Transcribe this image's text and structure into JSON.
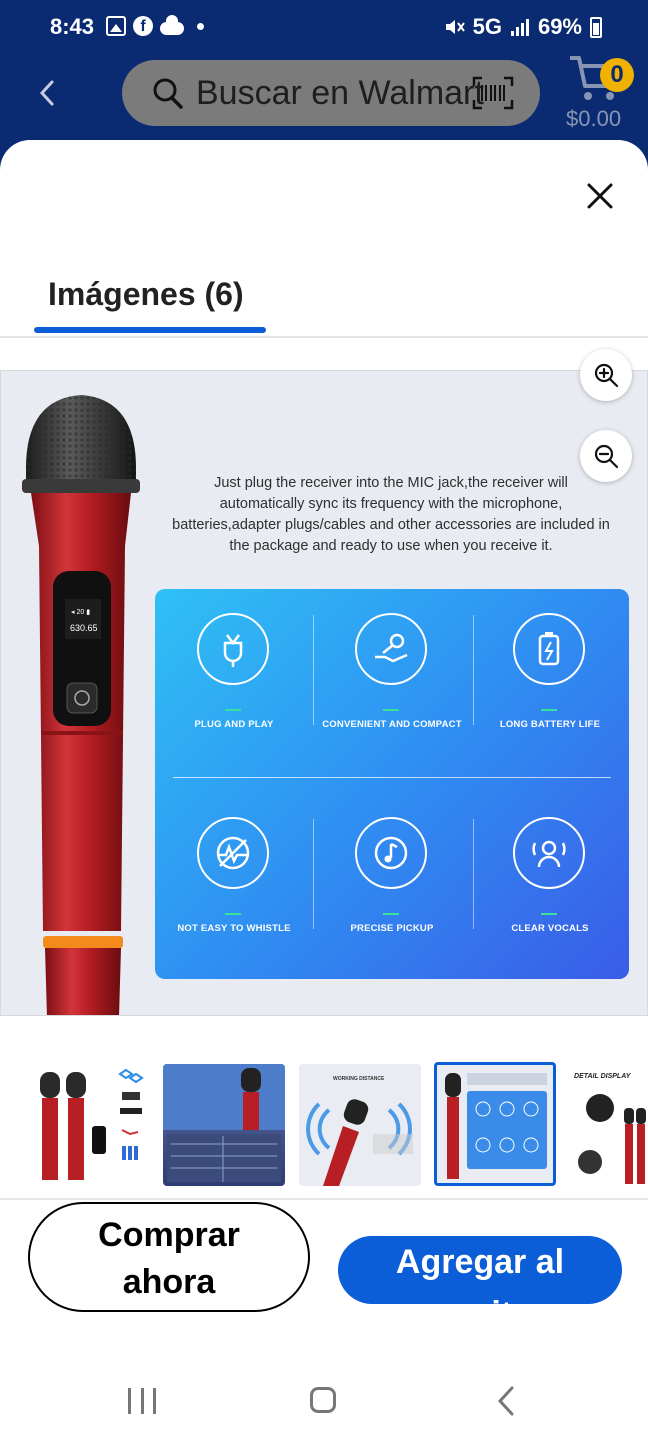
{
  "status_bar": {
    "time": "8:43",
    "network": "5G",
    "battery": "69%"
  },
  "header": {
    "search_placeholder": "Buscar en Walmart",
    "cart_count": "0",
    "cart_total": "$0.00"
  },
  "tab": {
    "label": "Imágenes (6)"
  },
  "main_image": {
    "caption": "Just plug the receiver into the MIC jack,the receiver will automatically sync its frequency with the microphone, batteries,adapter plugs/cables and other accessories are included in the package and ready to use when you receive it.",
    "mic_display": [
      "630.65"
    ],
    "features": [
      {
        "label": "PLUG AND PLAY",
        "icon": "plug-icon"
      },
      {
        "label": "CONVENIENT AND COMPACT",
        "icon": "hand-mic-icon"
      },
      {
        "label": "LONG BATTERY LIFE",
        "icon": "battery-icon"
      },
      {
        "label": "NOT EASY TO WHISTLE",
        "icon": "no-feedback-icon"
      },
      {
        "label": "PRECISE PICKUP",
        "icon": "music-note-icon"
      },
      {
        "label": "CLEAR VOCALS",
        "icon": "voice-icon"
      }
    ]
  },
  "thumbnails": [
    {
      "label": ""
    },
    {
      "label": ""
    },
    {
      "label": "WORKING DISTANCE"
    },
    {
      "label": ""
    },
    {
      "label": "DETAIL DISPLAY"
    }
  ],
  "actions": {
    "buy_now": [
      "Comprar",
      "ahora"
    ],
    "add_to_cart": "Agregar al carrito"
  },
  "colors": {
    "header_bg": "#0a2a72",
    "accent": "#0b5ed7",
    "badge": "#f0b100",
    "mic_red": "#b81f24"
  }
}
